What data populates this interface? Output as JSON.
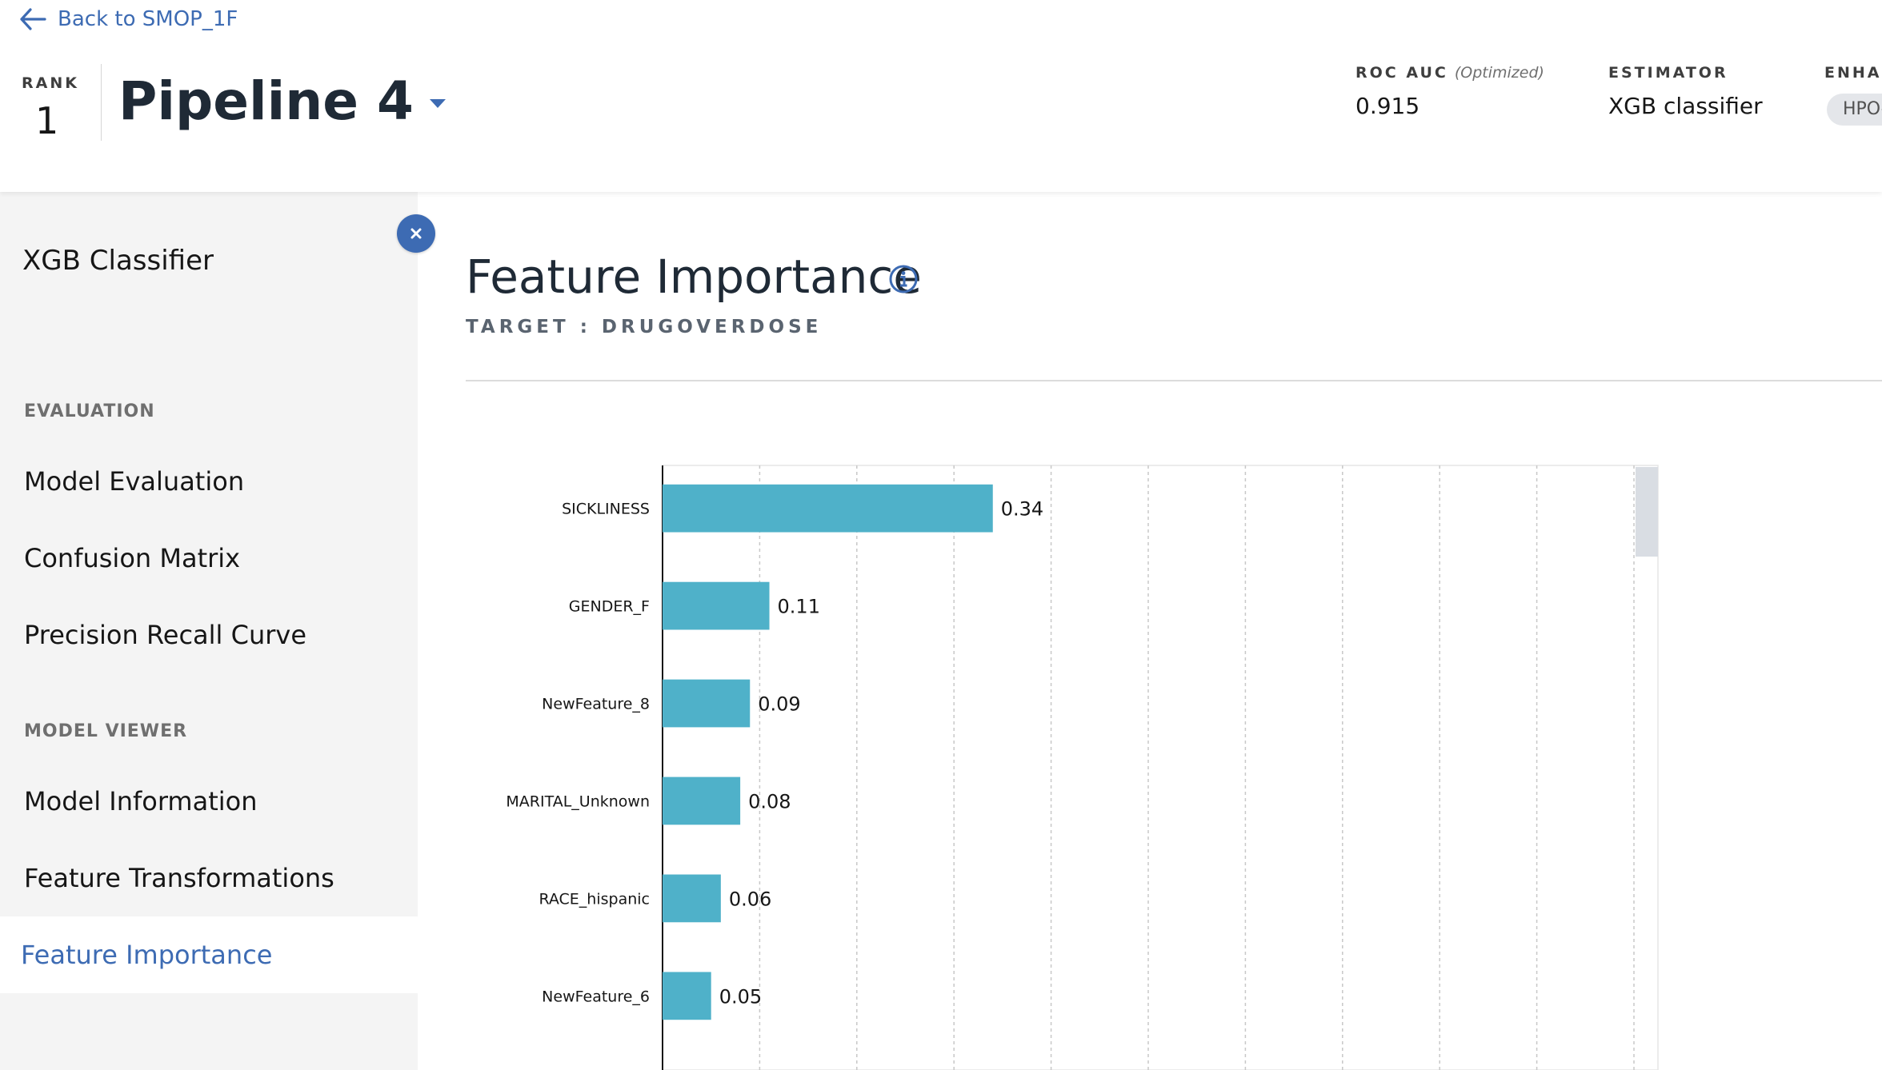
{
  "header": {
    "back_label": "Back to SMOP_1F",
    "rank_label": "RANK",
    "rank_value": "1",
    "pipeline_title": "Pipeline 4",
    "metric_label": "ROC AUC",
    "metric_qualifier": "(Optimized)",
    "metric_value": "0.915",
    "estimator_label": "ESTIMATOR",
    "estimator_value": "XGB classifier",
    "enhancements_label": "ENHAI",
    "enhancement_tag": "HPO-"
  },
  "sidebar": {
    "title": "XGB Classifier",
    "sections": [
      {
        "label": "EVALUATION",
        "items": [
          "Model Evaluation",
          "Confusion Matrix",
          "Precision Recall Curve"
        ]
      },
      {
        "label": "MODEL VIEWER",
        "items": [
          "Model Information",
          "Feature Transformations",
          "Feature Importance"
        ]
      }
    ],
    "active_item": "Feature Importance"
  },
  "main": {
    "title": "Feature Importance",
    "target_label": "TARGET : DRUGOVERDOSE"
  },
  "colors": {
    "accent": "#3d6bb3",
    "bar": "#4fb1c9",
    "sidebar_bg": "#f4f4f4"
  },
  "icons": [
    "arrow-left-icon",
    "chevron-down-icon",
    "close-icon",
    "info-icon"
  ],
  "chart_data": {
    "type": "bar",
    "orientation": "horizontal",
    "categories": [
      "SICKLINESS",
      "GENDER_F",
      "NewFeature_8",
      "MARITAL_Unknown",
      "RACE_hispanic",
      "NewFeature_6"
    ],
    "values": [
      0.34,
      0.11,
      0.09,
      0.08,
      0.06,
      0.05
    ],
    "value_labels": [
      "0.34",
      "0.11",
      "0.09",
      "0.08",
      "0.06",
      "0.05"
    ],
    "xlim": [
      0,
      1.0
    ],
    "grid": true
  }
}
